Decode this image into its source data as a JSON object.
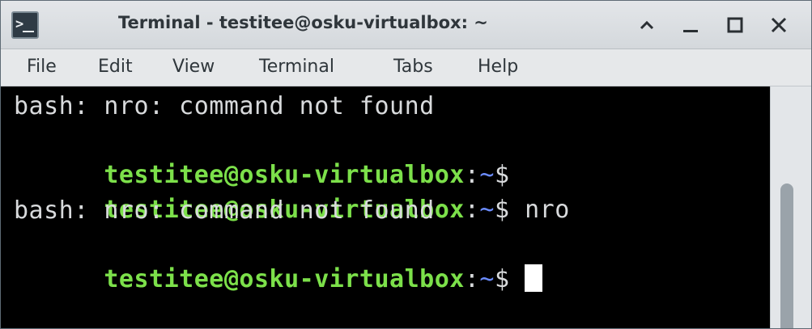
{
  "window": {
    "title": "Terminal - testitee@osku-virtualbox: ~",
    "icon": "terminal-icon",
    "controls": [
      "chevron-up-icon",
      "minimize-icon",
      "maximize-icon",
      "close-icon"
    ]
  },
  "menu": {
    "items": [
      "File",
      "Edit",
      "View",
      "Terminal",
      "Tabs",
      "Help"
    ]
  },
  "terminal": {
    "lines": [
      {
        "type": "output",
        "text": "bash: nro: command not found"
      },
      {
        "type": "prompt",
        "user": "testitee@osku-virtualbox",
        "colon": ":",
        "path": "~",
        "dollar": "$",
        "command": ""
      },
      {
        "type": "prompt",
        "user": "testitee@osku-virtualbox",
        "colon": ":",
        "path": "~",
        "dollar": "$",
        "command": " nro"
      },
      {
        "type": "output",
        "text": "bash: nro: command not found"
      },
      {
        "type": "prompt",
        "user": "testitee@osku-virtualbox",
        "colon": ":",
        "path": "~",
        "dollar": "$",
        "command": " "
      }
    ]
  },
  "colors": {
    "prompt_user": "#7ce04a",
    "prompt_path": "#6b8cff",
    "text": "#d8dadc",
    "background": "#000000"
  }
}
